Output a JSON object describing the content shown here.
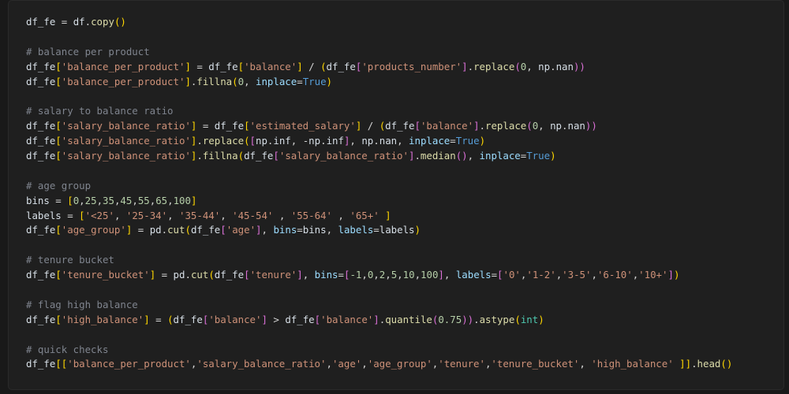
{
  "editor": {
    "language": "python",
    "lines": [
      [
        [
          "df_fe",
          "var"
        ],
        [
          " = ",
          "op"
        ],
        [
          "df",
          "var"
        ],
        [
          ".",
          "punc"
        ],
        [
          "copy",
          "fn"
        ],
        [
          "()",
          "br1"
        ]
      ],
      [],
      [
        [
          "# balance per product",
          "comment"
        ]
      ],
      [
        [
          "df_fe",
          "var"
        ],
        [
          "[",
          "br1"
        ],
        [
          "'balance_per_product'",
          "str"
        ],
        [
          "]",
          "br1"
        ],
        [
          " = ",
          "op"
        ],
        [
          "df_fe",
          "var"
        ],
        [
          "[",
          "br1"
        ],
        [
          "'balance'",
          "str"
        ],
        [
          "]",
          "br1"
        ],
        [
          " / ",
          "op"
        ],
        [
          "(",
          "br1"
        ],
        [
          "df_fe",
          "var"
        ],
        [
          "[",
          "br2"
        ],
        [
          "'products_number'",
          "str"
        ],
        [
          "]",
          "br2"
        ],
        [
          ".",
          "punc"
        ],
        [
          "replace",
          "fn"
        ],
        [
          "(",
          "br2"
        ],
        [
          "0",
          "num"
        ],
        [
          ", ",
          "punc"
        ],
        [
          "np",
          "var"
        ],
        [
          ".",
          "punc"
        ],
        [
          "nan",
          "var"
        ],
        [
          "))",
          "br2"
        ]
      ],
      [
        [
          "df_fe",
          "var"
        ],
        [
          "[",
          "br1"
        ],
        [
          "'balance_per_product'",
          "str"
        ],
        [
          "]",
          "br1"
        ],
        [
          ".",
          "punc"
        ],
        [
          "fillna",
          "fn"
        ],
        [
          "(",
          "br1"
        ],
        [
          "0",
          "num"
        ],
        [
          ", ",
          "punc"
        ],
        [
          "inplace",
          "param"
        ],
        [
          "=",
          "op"
        ],
        [
          "True",
          "kw"
        ],
        [
          ")",
          "br1"
        ]
      ],
      [],
      [
        [
          "# salary to balance ratio",
          "comment"
        ]
      ],
      [
        [
          "df_fe",
          "var"
        ],
        [
          "[",
          "br1"
        ],
        [
          "'salary_balance_ratio'",
          "str"
        ],
        [
          "]",
          "br1"
        ],
        [
          " = ",
          "op"
        ],
        [
          "df_fe",
          "var"
        ],
        [
          "[",
          "br1"
        ],
        [
          "'estimated_salary'",
          "str"
        ],
        [
          "]",
          "br1"
        ],
        [
          " / ",
          "op"
        ],
        [
          "(",
          "br1"
        ],
        [
          "df_fe",
          "var"
        ],
        [
          "[",
          "br2"
        ],
        [
          "'balance'",
          "str"
        ],
        [
          "]",
          "br2"
        ],
        [
          ".",
          "punc"
        ],
        [
          "replace",
          "fn"
        ],
        [
          "(",
          "br2"
        ],
        [
          "0",
          "num"
        ],
        [
          ", ",
          "punc"
        ],
        [
          "np",
          "var"
        ],
        [
          ".",
          "punc"
        ],
        [
          "nan",
          "var"
        ],
        [
          "))",
          "br2"
        ]
      ],
      [
        [
          "df_fe",
          "var"
        ],
        [
          "[",
          "br1"
        ],
        [
          "'salary_balance_ratio'",
          "str"
        ],
        [
          "]",
          "br1"
        ],
        [
          ".",
          "punc"
        ],
        [
          "replace",
          "fn"
        ],
        [
          "(",
          "br1"
        ],
        [
          "[",
          "br2"
        ],
        [
          "np",
          "var"
        ],
        [
          ".",
          "punc"
        ],
        [
          "inf",
          "var"
        ],
        [
          ", -",
          "op"
        ],
        [
          "np",
          "var"
        ],
        [
          ".",
          "punc"
        ],
        [
          "inf",
          "var"
        ],
        [
          "]",
          "br2"
        ],
        [
          ", ",
          "punc"
        ],
        [
          "np",
          "var"
        ],
        [
          ".",
          "punc"
        ],
        [
          "nan",
          "var"
        ],
        [
          ", ",
          "punc"
        ],
        [
          "inplace",
          "param"
        ],
        [
          "=",
          "op"
        ],
        [
          "True",
          "kw"
        ],
        [
          ")",
          "br1"
        ]
      ],
      [
        [
          "df_fe",
          "var"
        ],
        [
          "[",
          "br1"
        ],
        [
          "'salary_balance_ratio'",
          "str"
        ],
        [
          "]",
          "br1"
        ],
        [
          ".",
          "punc"
        ],
        [
          "fillna",
          "fn"
        ],
        [
          "(",
          "br1"
        ],
        [
          "df_fe",
          "var"
        ],
        [
          "[",
          "br2"
        ],
        [
          "'salary_balance_ratio'",
          "str"
        ],
        [
          "]",
          "br2"
        ],
        [
          ".",
          "punc"
        ],
        [
          "median",
          "fn"
        ],
        [
          "()",
          "br2"
        ],
        [
          ", ",
          "punc"
        ],
        [
          "inplace",
          "param"
        ],
        [
          "=",
          "op"
        ],
        [
          "True",
          "kw"
        ],
        [
          ")",
          "br1"
        ]
      ],
      [],
      [
        [
          "# age group",
          "comment"
        ]
      ],
      [
        [
          "bins",
          "var"
        ],
        [
          " = ",
          "op"
        ],
        [
          "[",
          "br1"
        ],
        [
          "0",
          "num"
        ],
        [
          ",",
          "punc"
        ],
        [
          "25",
          "num"
        ],
        [
          ",",
          "punc"
        ],
        [
          "35",
          "num"
        ],
        [
          ",",
          "punc"
        ],
        [
          "45",
          "num"
        ],
        [
          ",",
          "punc"
        ],
        [
          "55",
          "num"
        ],
        [
          ",",
          "punc"
        ],
        [
          "65",
          "num"
        ],
        [
          ",",
          "punc"
        ],
        [
          "100",
          "num"
        ],
        [
          "]",
          "br1"
        ]
      ],
      [
        [
          "labels",
          "var"
        ],
        [
          " = ",
          "op"
        ],
        [
          "[",
          "br1"
        ],
        [
          "'<25'",
          "str"
        ],
        [
          ", ",
          "punc"
        ],
        [
          "'25-34'",
          "str"
        ],
        [
          ", ",
          "punc"
        ],
        [
          "'35-44'",
          "str"
        ],
        [
          ", ",
          "punc"
        ],
        [
          "'45-54'",
          "str"
        ],
        [
          " , ",
          "punc"
        ],
        [
          "'55-64'",
          "str"
        ],
        [
          " , ",
          "punc"
        ],
        [
          "'65+'",
          "str"
        ],
        [
          " ",
          "punc"
        ],
        [
          "]",
          "br1"
        ]
      ],
      [
        [
          "df_fe",
          "var"
        ],
        [
          "[",
          "br1"
        ],
        [
          "'age_group'",
          "str"
        ],
        [
          "]",
          "br1"
        ],
        [
          " = ",
          "op"
        ],
        [
          "pd",
          "var"
        ],
        [
          ".",
          "punc"
        ],
        [
          "cut",
          "fn"
        ],
        [
          "(",
          "br1"
        ],
        [
          "df_fe",
          "var"
        ],
        [
          "[",
          "br2"
        ],
        [
          "'age'",
          "str"
        ],
        [
          "]",
          "br2"
        ],
        [
          ", ",
          "punc"
        ],
        [
          "bins",
          "param"
        ],
        [
          "=",
          "op"
        ],
        [
          "bins",
          "var"
        ],
        [
          ", ",
          "punc"
        ],
        [
          "labels",
          "param"
        ],
        [
          "=",
          "op"
        ],
        [
          "labels",
          "var"
        ],
        [
          ")",
          "br1"
        ]
      ],
      [],
      [
        [
          "# tenure bucket",
          "comment"
        ]
      ],
      [
        [
          "df_fe",
          "var"
        ],
        [
          "[",
          "br1"
        ],
        [
          "'tenure_bucket'",
          "str"
        ],
        [
          "]",
          "br1"
        ],
        [
          " = ",
          "op"
        ],
        [
          "pd",
          "var"
        ],
        [
          ".",
          "punc"
        ],
        [
          "cut",
          "fn"
        ],
        [
          "(",
          "br1"
        ],
        [
          "df_fe",
          "var"
        ],
        [
          "[",
          "br2"
        ],
        [
          "'tenure'",
          "str"
        ],
        [
          "]",
          "br2"
        ],
        [
          ", ",
          "punc"
        ],
        [
          "bins",
          "param"
        ],
        [
          "=",
          "op"
        ],
        [
          "[",
          "br2"
        ],
        [
          "-1",
          "num"
        ],
        [
          ",",
          "punc"
        ],
        [
          "0",
          "num"
        ],
        [
          ",",
          "punc"
        ],
        [
          "2",
          "num"
        ],
        [
          ",",
          "punc"
        ],
        [
          "5",
          "num"
        ],
        [
          ",",
          "punc"
        ],
        [
          "10",
          "num"
        ],
        [
          ",",
          "punc"
        ],
        [
          "100",
          "num"
        ],
        [
          "]",
          "br2"
        ],
        [
          ", ",
          "punc"
        ],
        [
          "labels",
          "param"
        ],
        [
          "=",
          "op"
        ],
        [
          "[",
          "br2"
        ],
        [
          "'0'",
          "str"
        ],
        [
          ",",
          "punc"
        ],
        [
          "'1-2'",
          "str"
        ],
        [
          ",",
          "punc"
        ],
        [
          "'3-5'",
          "str"
        ],
        [
          ",",
          "punc"
        ],
        [
          "'6-10'",
          "str"
        ],
        [
          ",",
          "punc"
        ],
        [
          "'10+'",
          "str"
        ],
        [
          "]",
          "br2"
        ],
        [
          ")",
          "br1"
        ]
      ],
      [],
      [
        [
          "# flag high balance",
          "comment"
        ]
      ],
      [
        [
          "df_fe",
          "var"
        ],
        [
          "[",
          "br1"
        ],
        [
          "'high_balance'",
          "str"
        ],
        [
          "]",
          "br1"
        ],
        [
          " = ",
          "op"
        ],
        [
          "(",
          "br1"
        ],
        [
          "df_fe",
          "var"
        ],
        [
          "[",
          "br2"
        ],
        [
          "'balance'",
          "str"
        ],
        [
          "]",
          "br2"
        ],
        [
          " > ",
          "op"
        ],
        [
          "df_fe",
          "var"
        ],
        [
          "[",
          "br2"
        ],
        [
          "'balance'",
          "str"
        ],
        [
          "]",
          "br2"
        ],
        [
          ".",
          "punc"
        ],
        [
          "quantile",
          "fn"
        ],
        [
          "(",
          "br2"
        ],
        [
          "0.75",
          "num"
        ],
        [
          "))",
          "br2"
        ],
        [
          ".",
          "punc"
        ],
        [
          "astype",
          "fn"
        ],
        [
          "(",
          "br1"
        ],
        [
          "int",
          "cls"
        ],
        [
          ")",
          "br1"
        ]
      ],
      [],
      [
        [
          "# quick checks",
          "comment"
        ]
      ],
      [
        [
          "df_fe",
          "var"
        ],
        [
          "[[",
          "br1"
        ],
        [
          "'balance_per_product'",
          "str"
        ],
        [
          ",",
          "punc"
        ],
        [
          "'salary_balance_ratio'",
          "str"
        ],
        [
          ",",
          "punc"
        ],
        [
          "'age'",
          "str"
        ],
        [
          ",",
          "punc"
        ],
        [
          "'age_group'",
          "str"
        ],
        [
          ",",
          "punc"
        ],
        [
          "'tenure'",
          "str"
        ],
        [
          ",",
          "punc"
        ],
        [
          "'tenure_bucket'",
          "str"
        ],
        [
          ", ",
          "punc"
        ],
        [
          "'high_balance'",
          "str"
        ],
        [
          " ",
          "punc"
        ],
        [
          "]]",
          "br1"
        ],
        [
          ".",
          "punc"
        ],
        [
          "head",
          "fn"
        ],
        [
          "()",
          "br1"
        ]
      ]
    ]
  }
}
